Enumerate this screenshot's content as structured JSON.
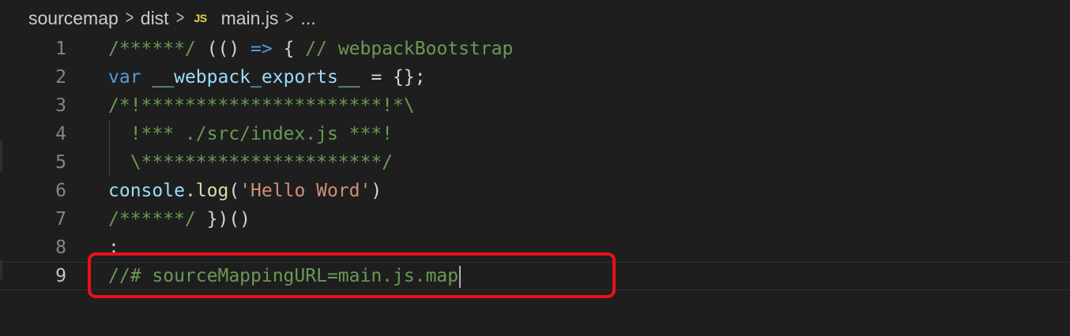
{
  "breadcrumb": {
    "items": [
      "sourcemap",
      "dist",
      "main.js",
      "..."
    ],
    "separator": ">",
    "file_icon_label": "JS",
    "file_icon_color": "#f1d14b"
  },
  "editor": {
    "language": "javascript",
    "current_line": 9,
    "lines": [
      {
        "number": "1",
        "tokens": [
          {
            "t": "c-comment",
            "text": "/******/"
          },
          {
            "t": "c-punct",
            "text": " (() "
          },
          {
            "t": "c-keyword",
            "text": "=>"
          },
          {
            "t": "c-punct",
            "text": " { "
          },
          {
            "t": "c-comment",
            "text": "// webpackBootstrap"
          }
        ]
      },
      {
        "number": "2",
        "tokens": [
          {
            "t": "c-keyword",
            "text": "var"
          },
          {
            "t": "c-punct",
            "text": " "
          },
          {
            "t": "c-var",
            "text": "__webpack_exports__"
          },
          {
            "t": "c-punct",
            "text": " = {};"
          }
        ]
      },
      {
        "number": "3",
        "tokens": [
          {
            "t": "c-comment",
            "text": "/*!**********************!*\\"
          }
        ]
      },
      {
        "number": "4",
        "guide": true,
        "tokens": [
          {
            "t": "c-comment",
            "text": "  !*** ./src/index.js ***!"
          }
        ]
      },
      {
        "number": "5",
        "guide": true,
        "tokens": [
          {
            "t": "c-comment",
            "text": "  \\**********************/"
          }
        ]
      },
      {
        "number": "6",
        "tokens": [
          {
            "t": "c-var",
            "text": "console"
          },
          {
            "t": "c-punct",
            "text": "."
          },
          {
            "t": "c-func",
            "text": "log"
          },
          {
            "t": "c-punct",
            "text": "("
          },
          {
            "t": "c-string",
            "text": "'Hello Word'"
          },
          {
            "t": "c-punct",
            "text": ")"
          }
        ]
      },
      {
        "number": "7",
        "tokens": [
          {
            "t": "c-comment",
            "text": "/******/"
          },
          {
            "t": "c-punct",
            "text": " })()"
          }
        ]
      },
      {
        "number": "8",
        "tokens": [
          {
            "t": "c-punct",
            "text": ";"
          }
        ]
      },
      {
        "number": "9",
        "cursor": true,
        "tokens": [
          {
            "t": "c-comment",
            "text": "//# sourceMappingURL=main.js.map"
          }
        ]
      }
    ]
  },
  "annotation": {
    "highlight_color": "#e8101a",
    "highlighted_line": 9
  }
}
